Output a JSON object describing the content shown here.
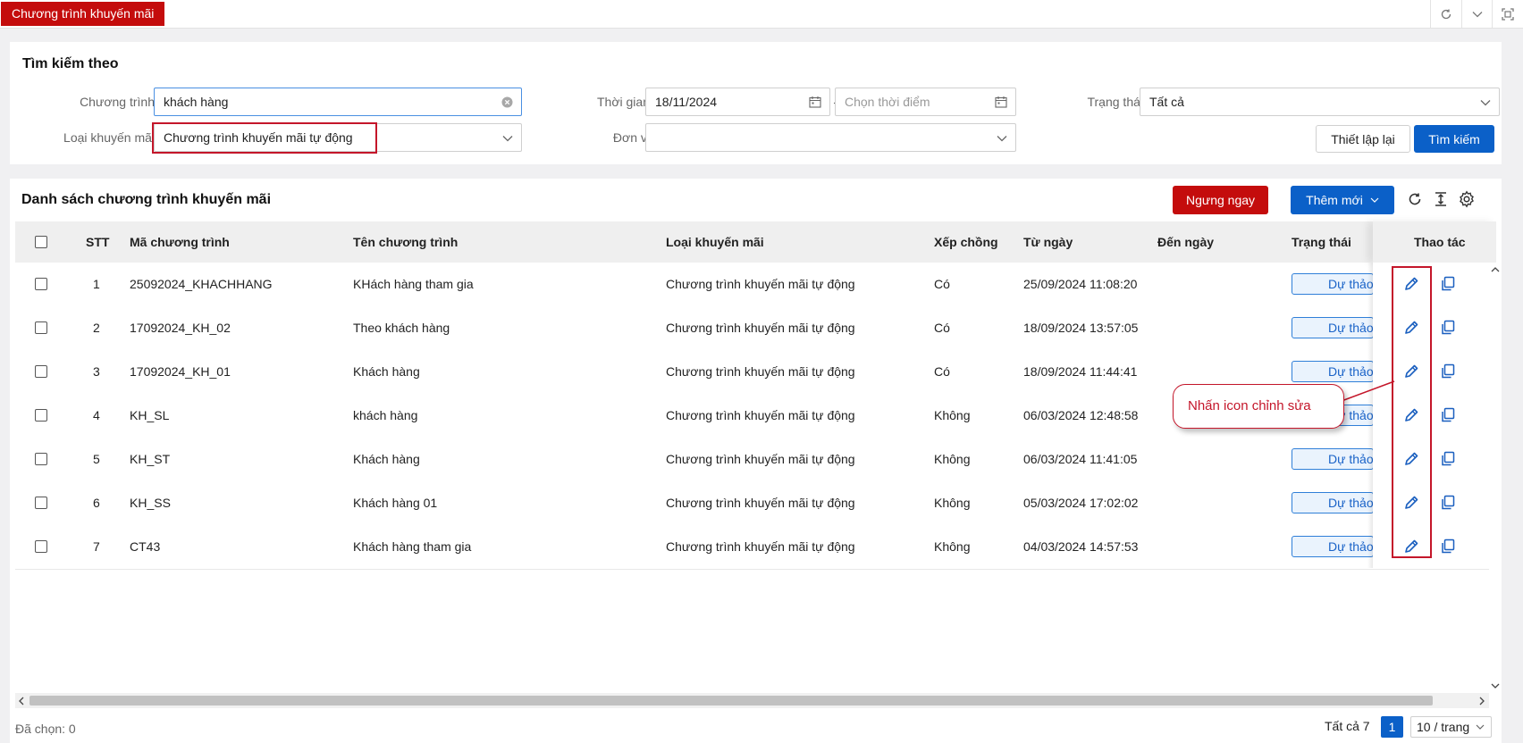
{
  "top_tab": {
    "label": "Chương trình khuyến mãi"
  },
  "search": {
    "title": "Tìm kiếm theo",
    "program_label": "Chương trình",
    "program_value": "khách hàng",
    "promo_type_label": "Loại khuyến mãi",
    "promo_type_value": "Chương trình khuyến mãi tự động",
    "time_label": "Thời gian",
    "time_from": "18/11/2024",
    "time_separator": "-",
    "time_to_placeholder": "Chọn thời điểm",
    "unit_label": "Đơn vị",
    "unit_value": "",
    "status_label": "Trạng thái",
    "status_value": "Tất cả",
    "reset_label": "Thiết lập lại",
    "search_label": "Tìm kiếm"
  },
  "list": {
    "title": "Danh sách chương trình khuyến mãi",
    "stop_label": "Ngưng ngay",
    "add_label": "Thêm mới",
    "columns": {
      "stt": "STT",
      "code": "Mã chương trình",
      "name": "Tên chương trình",
      "type": "Loại khuyến mãi",
      "stack": "Xếp chồng",
      "from": "Từ ngày",
      "to": "Đến ngày",
      "status": "Trạng thái",
      "actions": "Thao tác"
    },
    "rows": [
      {
        "stt": "1",
        "code": "25092024_KHACHHANG",
        "name": "KHách hàng tham gia",
        "type": "Chương trình khuyến mãi tự động",
        "stack": "Có",
        "from": "25/09/2024 11:08:20",
        "to": "",
        "status": "Dự thảo"
      },
      {
        "stt": "2",
        "code": "17092024_KH_02",
        "name": "Theo khách hàng",
        "type": "Chương trình khuyến mãi tự động",
        "stack": "Có",
        "from": "18/09/2024 13:57:05",
        "to": "",
        "status": "Dự thảo"
      },
      {
        "stt": "3",
        "code": "17092024_KH_01",
        "name": "Khách hàng",
        "type": "Chương trình khuyến mãi tự động",
        "stack": "Có",
        "from": "18/09/2024 11:44:41",
        "to": "",
        "status": "Dự thảo"
      },
      {
        "stt": "4",
        "code": "KH_SL",
        "name": "khách hàng",
        "type": "Chương trình khuyến mãi tự động",
        "stack": "Không",
        "from": "06/03/2024 12:48:58",
        "to": "",
        "status": "Dự thảo"
      },
      {
        "stt": "5",
        "code": "KH_ST",
        "name": "Khách hàng",
        "type": "Chương trình khuyến mãi tự động",
        "stack": "Không",
        "from": "06/03/2024 11:41:05",
        "to": "",
        "status": "Dự thảo"
      },
      {
        "stt": "6",
        "code": "KH_SS",
        "name": "Khách hàng 01",
        "type": "Chương trình khuyến mãi tự động",
        "stack": "Không",
        "from": "05/03/2024 17:02:02",
        "to": "",
        "status": "Dự thảo"
      },
      {
        "stt": "7",
        "code": "CT43",
        "name": "Khách hàng tham gia",
        "type": "Chương trình khuyến mãi tự động",
        "stack": "Không",
        "from": "04/03/2024 14:57:53",
        "to": "",
        "status": "Dự thảo"
      }
    ]
  },
  "callout": {
    "text": "Nhấn icon chỉnh sửa"
  },
  "footer": {
    "selected": "Đã chọn: 0",
    "total": "Tất cả 7",
    "page": "1",
    "page_size": "10 / trang"
  },
  "colors": {
    "brand_red": "#c40c0c",
    "primary_blue": "#0b60c8",
    "annotation_red": "#c4162a"
  }
}
